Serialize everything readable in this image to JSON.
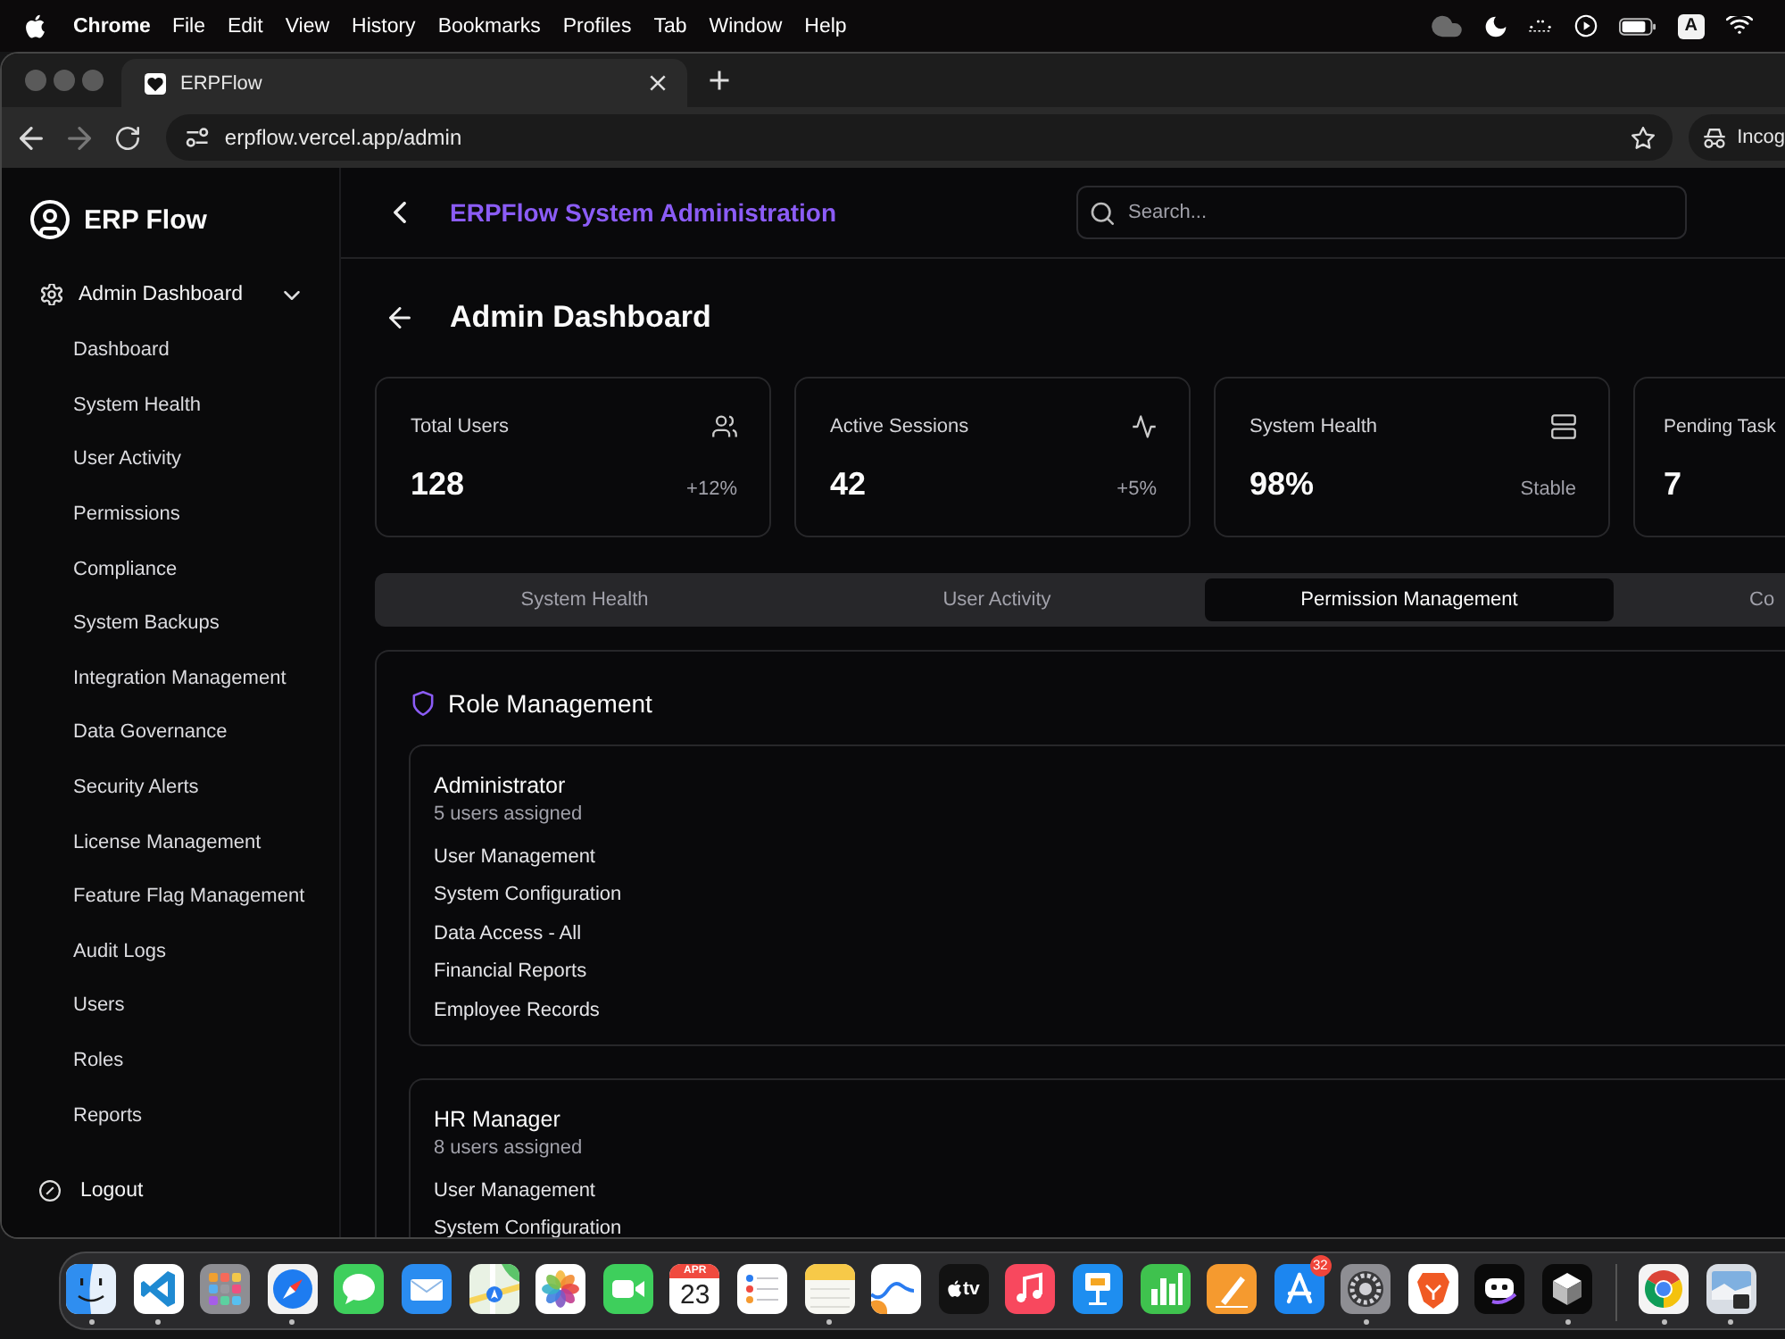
{
  "menu_bar": {
    "app_name": "Chrome",
    "menus": [
      "File",
      "Edit",
      "View",
      "History",
      "Bookmarks",
      "Profiles",
      "Tab",
      "Window",
      "Help"
    ],
    "input_source": "A"
  },
  "browser": {
    "tabs": [
      {
        "title": "ERPFlow",
        "selected": true
      }
    ],
    "nav_buttons": [
      {
        "kind": "back",
        "disabled": false
      },
      {
        "kind": "forward",
        "disabled": true
      },
      {
        "kind": "reload",
        "disabled": false
      }
    ],
    "url": "erpflow.vercel.app/admin",
    "profile_button": "Incog"
  },
  "sidebar": {
    "brand": "ERP Flow",
    "section": {
      "label": "Admin Dashboard",
      "expanded": true,
      "items": [
        "Dashboard",
        "System Health",
        "User Activity",
        "Permissions",
        "Compliance",
        "System Backups",
        "Integration Management",
        "Data Governance",
        "Security Alerts",
        "License Management",
        "Feature Flag Management",
        "Audit Logs",
        "Users",
        "Roles",
        "Reports"
      ]
    },
    "logout": "Logout"
  },
  "header": {
    "title": "ERPFlow System Administration",
    "search": {
      "placeholder": "Search..."
    }
  },
  "page": {
    "title": "Admin Dashboard"
  },
  "stats": [
    {
      "kind": "users",
      "label": "Total Users",
      "value": "128",
      "note": "+12%"
    },
    {
      "kind": "activity",
      "label": "Active Sessions",
      "value": "42",
      "note": "+5%"
    },
    {
      "kind": "server",
      "label": "System Health",
      "value": "98%",
      "note": "Stable"
    },
    {
      "kind": "tasks",
      "label": "Pending Task",
      "value": "7"
    }
  ],
  "tabs": [
    {
      "label": "System Health",
      "selected": false
    },
    {
      "label": "User Activity",
      "selected": false
    },
    {
      "label": "Permission Management",
      "selected": true
    },
    {
      "label": "Co",
      "selected": false
    }
  ],
  "role_management": {
    "title": "Role Management",
    "roles": [
      {
        "name": "Administrator",
        "users": "5 users assigned",
        "permissions": [
          "User Management",
          "System Configuration",
          "Data Access - All",
          "Financial Reports",
          "Employee Records"
        ]
      },
      {
        "name": "HR Manager",
        "users": "8 users assigned",
        "permissions": [
          "User Management",
          "System Configuration"
        ]
      }
    ]
  },
  "dock": {
    "apps": [
      {
        "kind": "finder",
        "running": true
      },
      {
        "kind": "code",
        "running": true
      },
      {
        "kind": "launchpad",
        "running": false
      },
      {
        "kind": "safari",
        "running": true
      },
      {
        "kind": "messages",
        "running": false
      },
      {
        "kind": "mail",
        "running": false
      },
      {
        "kind": "maps",
        "running": false
      },
      {
        "kind": "photos",
        "running": false
      },
      {
        "kind": "facetime",
        "running": false
      },
      {
        "kind": "calendar",
        "running": false,
        "month": "APR",
        "day": "23"
      },
      {
        "kind": "reminders",
        "running": false
      },
      {
        "kind": "notes",
        "running": true
      },
      {
        "kind": "freeform",
        "running": false
      },
      {
        "kind": "tv",
        "running": false,
        "label": "tv"
      },
      {
        "kind": "music",
        "running": false
      },
      {
        "kind": "keynote",
        "running": false
      },
      {
        "kind": "numbers",
        "running": false
      },
      {
        "kind": "pages",
        "running": false
      },
      {
        "kind": "appstore",
        "running": false,
        "badge": "32"
      },
      {
        "kind": "settings",
        "running": true
      },
      {
        "kind": "brave",
        "running": false
      },
      {
        "kind": "bot",
        "running": false
      },
      {
        "kind": "cube",
        "running": true
      }
    ],
    "recent": [
      {
        "kind": "chrome",
        "running": true
      },
      {
        "kind": "preview",
        "running": true
      }
    ]
  }
}
